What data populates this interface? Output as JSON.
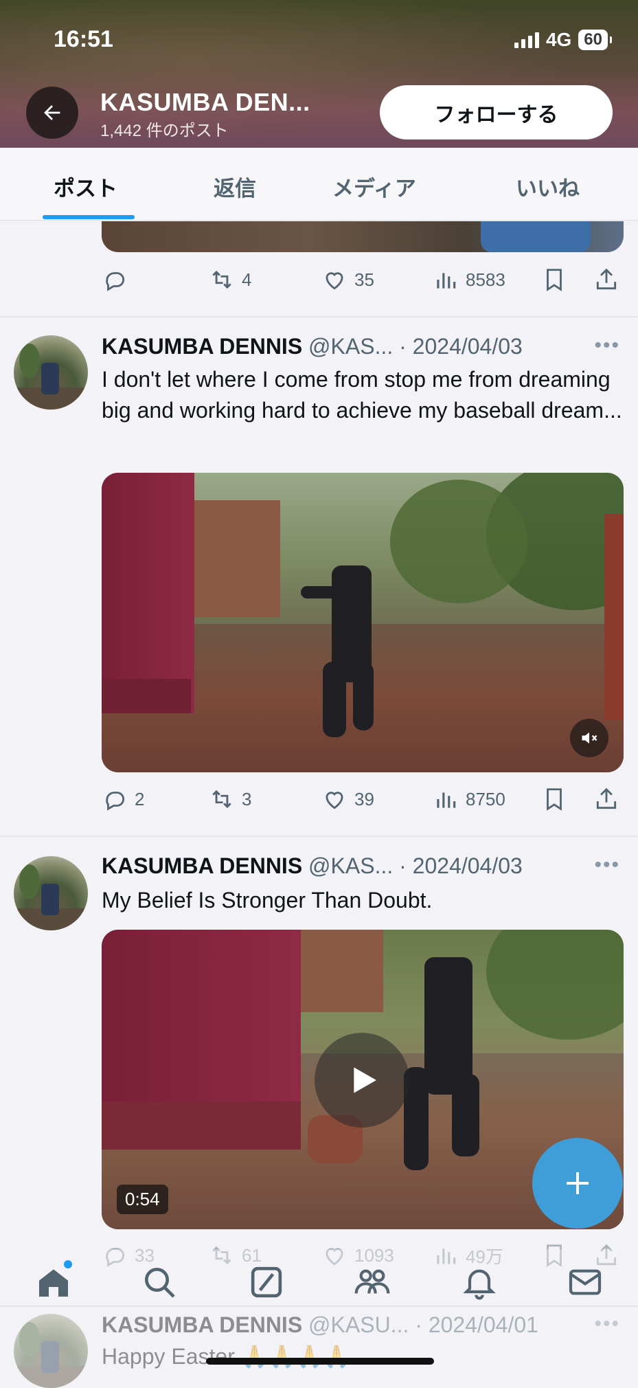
{
  "status": {
    "time": "16:51",
    "network": "4G",
    "battery": "60"
  },
  "header": {
    "title": "KASUMBA DEN...",
    "post_count": "1,442 件のポスト",
    "follow_label": "フォローする"
  },
  "tabs": [
    {
      "label": "ポスト",
      "active": true
    },
    {
      "label": "返信",
      "active": false
    },
    {
      "label": "メディア",
      "active": false
    },
    {
      "label": "いいね",
      "active": false
    }
  ],
  "posts": [
    {
      "partial": true,
      "replies": "",
      "reposts": "4",
      "likes": "35",
      "views": "8583"
    },
    {
      "name": "KASUMBA DENNIS",
      "handle": "@KAS...",
      "date": "· 2024/04/03",
      "text": "I don't let where I come from stop me from dreaming big and working hard to achieve my baseball dream...",
      "media": "video-muted",
      "replies": "2",
      "reposts": "3",
      "likes": "39",
      "views": "8750"
    },
    {
      "name": "KASUMBA DENNIS",
      "handle": "@KAS...",
      "date": "· 2024/04/03",
      "text": "My Belief Is Stronger Than Doubt.",
      "media": "video",
      "duration": "0:54",
      "replies": "33",
      "reposts": "61",
      "likes": "1093",
      "views": "49万"
    },
    {
      "name": "KASUMBA DENNIS",
      "handle": "@KASU...",
      "date": "· 2024/04/01",
      "text": "Happy Easter 🙏🙏🙏🙏"
    }
  ],
  "icons": {
    "back": "arrow-left-icon",
    "reply": "comment-icon",
    "repost": "repost-icon",
    "like": "heart-icon",
    "views": "bar-chart-icon",
    "bookmark": "bookmark-icon",
    "share": "share-icon",
    "mute": "speaker-muted-icon",
    "play": "play-icon",
    "compose": "plus-icon",
    "nav": [
      "home-icon",
      "search-icon",
      "grok-icon",
      "communities-icon",
      "bell-icon",
      "mail-icon"
    ]
  },
  "colors": {
    "accent": "#1d9bf0",
    "text": "#0f1419",
    "muted": "#536471",
    "fab": "#3f9ed8"
  }
}
